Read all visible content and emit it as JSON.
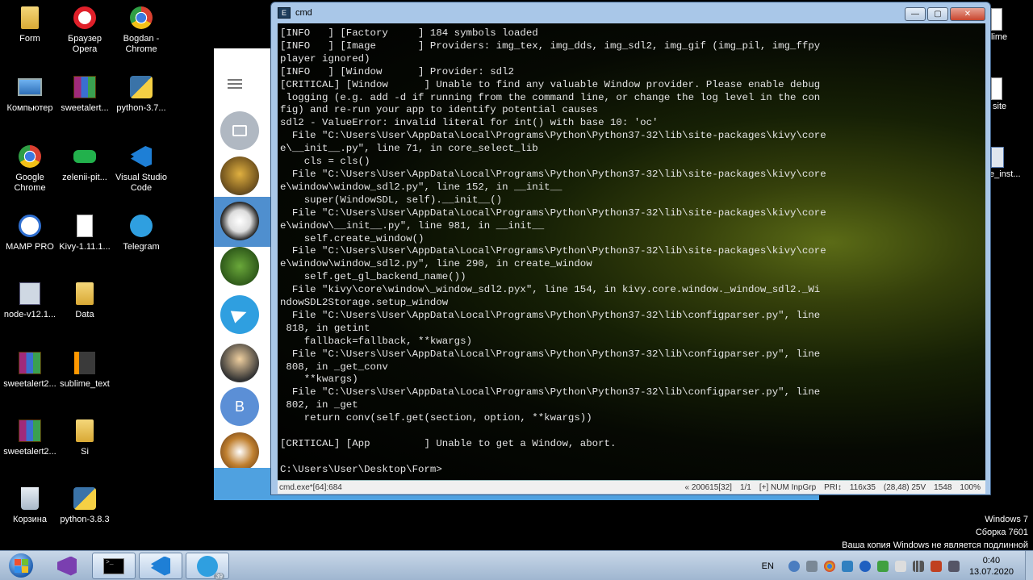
{
  "desktop": {
    "icons": [
      {
        "label": "Form",
        "icon": "folder-icon"
      },
      {
        "label": "Браузер Opera",
        "icon": "opera-icon"
      },
      {
        "label": "Bogdan - Chrome",
        "icon": "chrome-icon"
      },
      {
        "label": "Компьютер",
        "icon": "computer-icon"
      },
      {
        "label": "sweetalert...",
        "icon": "winrar-icon"
      },
      {
        "label": "python-3.7...",
        "icon": "python-installer-icon"
      },
      {
        "label": "Google Chrome",
        "icon": "chrome-icon"
      },
      {
        "label": "zelenii-pit...",
        "icon": "image-icon"
      },
      {
        "label": "Visual Studio Code",
        "icon": "vscode-icon"
      },
      {
        "label": "MAMP PRO",
        "icon": "mamp-icon"
      },
      {
        "label": "Kivy-1.11.1...",
        "icon": "file-icon"
      },
      {
        "label": "Telegram",
        "icon": "telegram-icon"
      },
      {
        "label": "node-v12.1...",
        "icon": "installer-icon"
      },
      {
        "label": "Data",
        "icon": "folder-icon"
      },
      {
        "label": "sweetalert2...",
        "icon": "winrar-icon"
      },
      {
        "label": "sublime_text",
        "icon": "sublime-icon"
      },
      {
        "label": "sweetalert2...",
        "icon": "winrar-icon"
      },
      {
        "label": "Si",
        "icon": "folder-icon"
      },
      {
        "label": "Корзина",
        "icon": "recycle-bin-icon"
      },
      {
        "label": "python-3.8.3",
        "icon": "python-installer-icon"
      }
    ],
    "right_icons": [
      {
        "label": "lime"
      },
      {
        "label": "site"
      },
      {
        "label": "e_inst..."
      }
    ]
  },
  "cmd": {
    "title": "cmd",
    "console_text": "[INFO   ] [Factory     ] 184 symbols loaded\n[INFO   ] [Image       ] Providers: img_tex, img_dds, img_sdl2, img_gif (img_pil, img_ffpy\nplayer ignored)\n[INFO   ] [Window      ] Provider: sdl2\n[CRITICAL] [Window      ] Unable to find any valuable Window provider. Please enable debug\n logging (e.g. add -d if running from the command line, or change the log level in the con\nfig) and re-run your app to identify potential causes\nsdl2 - ValueError: invalid literal for int() with base 10: 'oc'\n  File \"C:\\Users\\User\\AppData\\Local\\Programs\\Python\\Python37-32\\lib\\site-packages\\kivy\\core\ne\\__init__.py\", line 71, in core_select_lib\n    cls = cls()\n  File \"C:\\Users\\User\\AppData\\Local\\Programs\\Python\\Python37-32\\lib\\site-packages\\kivy\\core\ne\\window\\window_sdl2.py\", line 152, in __init__\n    super(WindowSDL, self).__init__()\n  File \"C:\\Users\\User\\AppData\\Local\\Programs\\Python\\Python37-32\\lib\\site-packages\\kivy\\core\ne\\window\\__init__.py\", line 981, in __init__\n    self.create_window()\n  File \"C:\\Users\\User\\AppData\\Local\\Programs\\Python\\Python37-32\\lib\\site-packages\\kivy\\core\ne\\window\\window_sdl2.py\", line 290, in create_window\n    self.get_gl_backend_name())\n  File \"kivy\\core\\window\\_window_sdl2.pyx\", line 154, in kivy.core.window._window_sdl2._Wi\nndowSDL2Storage.setup_window\n  File \"C:\\Users\\User\\AppData\\Local\\Programs\\Python\\Python37-32\\lib\\configparser.py\", line\n 818, in getint\n    fallback=fallback, **kwargs)\n  File \"C:\\Users\\User\\AppData\\Local\\Programs\\Python\\Python37-32\\lib\\configparser.py\", line\n 808, in _get_conv\n    **kwargs)\n  File \"C:\\Users\\User\\AppData\\Local\\Programs\\Python\\Python37-32\\lib\\configparser.py\", line\n 802, in _get\n    return conv(self.get(section, option, **kwargs))\n\n[CRITICAL] [App         ] Unable to get a Window, abort.\n\nC:\\Users\\User\\Desktop\\Form>",
    "status": {
      "left": "cmd.exe*[64]:684",
      "segments": [
        "« 200615[32]",
        "1/1",
        "[+] NUM InpGrp",
        "PRI↕",
        "116x35",
        "(28,48) 25V",
        "1548",
        "100%"
      ]
    }
  },
  "watermark": {
    "line1": "Windows 7",
    "line2": "Сборка 7601",
    "line3": "Ваша копия Windows не является подлинной"
  },
  "taskbar": {
    "lang": "EN",
    "time": "0:40",
    "date": "13.07.2020",
    "telegram_badge": "39"
  },
  "telegram": {
    "avatar_letter": "B"
  },
  "colors": {
    "taskbar": "#a9bfd8",
    "telegram_blue": "#4fa1e0",
    "console_text": "#e4e4e4"
  }
}
